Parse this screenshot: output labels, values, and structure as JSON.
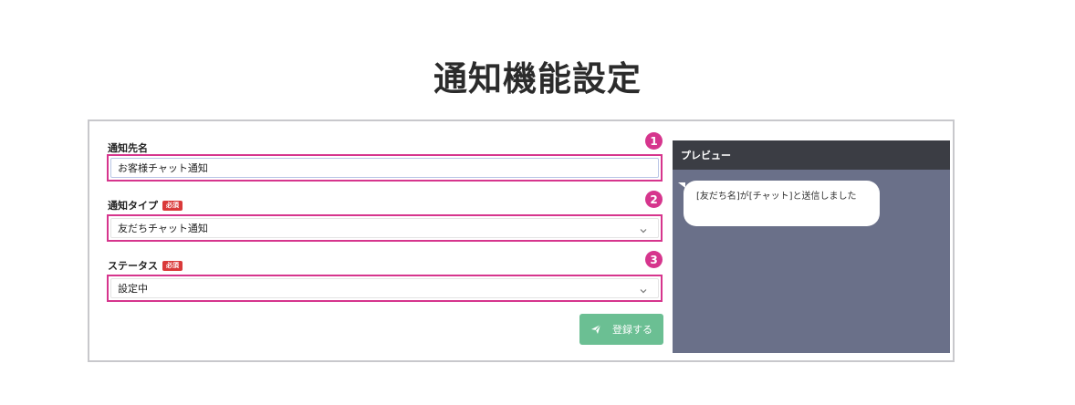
{
  "page": {
    "title": "通知機能設定"
  },
  "form": {
    "notify_name": {
      "label": "通知先名",
      "value": "お客様チャット通知"
    },
    "notify_type": {
      "label": "通知タイプ",
      "required": "必須",
      "value": "友だちチャット通知"
    },
    "status": {
      "label": "ステータス",
      "required": "必須",
      "value": "設定中"
    },
    "submit_label": "登録する"
  },
  "markers": [
    "1",
    "2",
    "3"
  ],
  "preview": {
    "header": "プレビュー",
    "message": "[友だち名]が[チャット]と送信しました"
  },
  "colors": {
    "highlight": "#d6358d",
    "submit": "#6bbf93",
    "required_badge": "#d93a3a",
    "preview_bg": "#6a7089",
    "preview_header": "#3b3d44"
  },
  "icons": {
    "submit": "send-icon",
    "select": "chevron-down-icon"
  }
}
